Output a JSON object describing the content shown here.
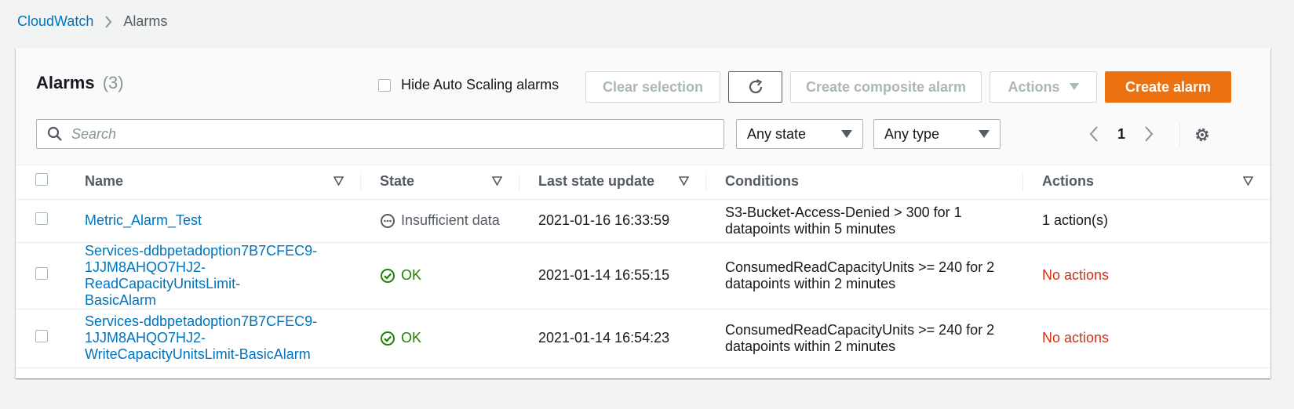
{
  "breadcrumb": {
    "root": "CloudWatch",
    "current": "Alarms"
  },
  "header": {
    "title": "Alarms",
    "count": "(3)"
  },
  "hide_autoscaling": {
    "label": "Hide Auto Scaling alarms",
    "checked": false
  },
  "buttons": {
    "clear": "Clear selection",
    "composite": "Create composite alarm",
    "actions": "Actions",
    "create": "Create alarm"
  },
  "search": {
    "placeholder": "Search",
    "value": ""
  },
  "filters": {
    "state": "Any state",
    "type": "Any type"
  },
  "pagination": {
    "current_page": "1"
  },
  "table": {
    "columns": {
      "name": "Name",
      "state": "State",
      "last_update": "Last state update",
      "conditions": "Conditions",
      "actions": "Actions"
    },
    "rows": [
      {
        "name": [
          "Metric_Alarm_Test"
        ],
        "state": "Insufficient data",
        "state_kind": "insufficient",
        "last_update": "2021-01-16 16:33:59",
        "conditions": [
          "S3-Bucket-Access-Denied > 300 for 1",
          "datapoints within 5 minutes"
        ],
        "actions": "1 action(s)",
        "actions_kind": "normal"
      },
      {
        "name": [
          "Services-ddbpetadoption7B7CFEC9-",
          "1JJM8AHQO7HJ2-ReadCapacityUnitsLimit-",
          "BasicAlarm"
        ],
        "state": "OK",
        "state_kind": "ok",
        "last_update": "2021-01-14 16:55:15",
        "conditions": [
          "ConsumedReadCapacityUnits >= 240 for 2",
          "datapoints within 2 minutes"
        ],
        "actions": "No actions",
        "actions_kind": "none"
      },
      {
        "name": [
          "Services-ddbpetadoption7B7CFEC9-",
          "1JJM8AHQO7HJ2-",
          "WriteCapacityUnitsLimit-BasicAlarm"
        ],
        "state": "OK",
        "state_kind": "ok",
        "last_update": "2021-01-14 16:54:23",
        "conditions": [
          "ConsumedReadCapacityUnits >= 240 for 2",
          "datapoints within 2 minutes"
        ],
        "actions": "No actions",
        "actions_kind": "none"
      }
    ]
  },
  "colors": {
    "link": "#0073bb",
    "primary": "#ec7211",
    "ok": "#1d8102",
    "error": "#d13212",
    "muted": "#879596"
  }
}
